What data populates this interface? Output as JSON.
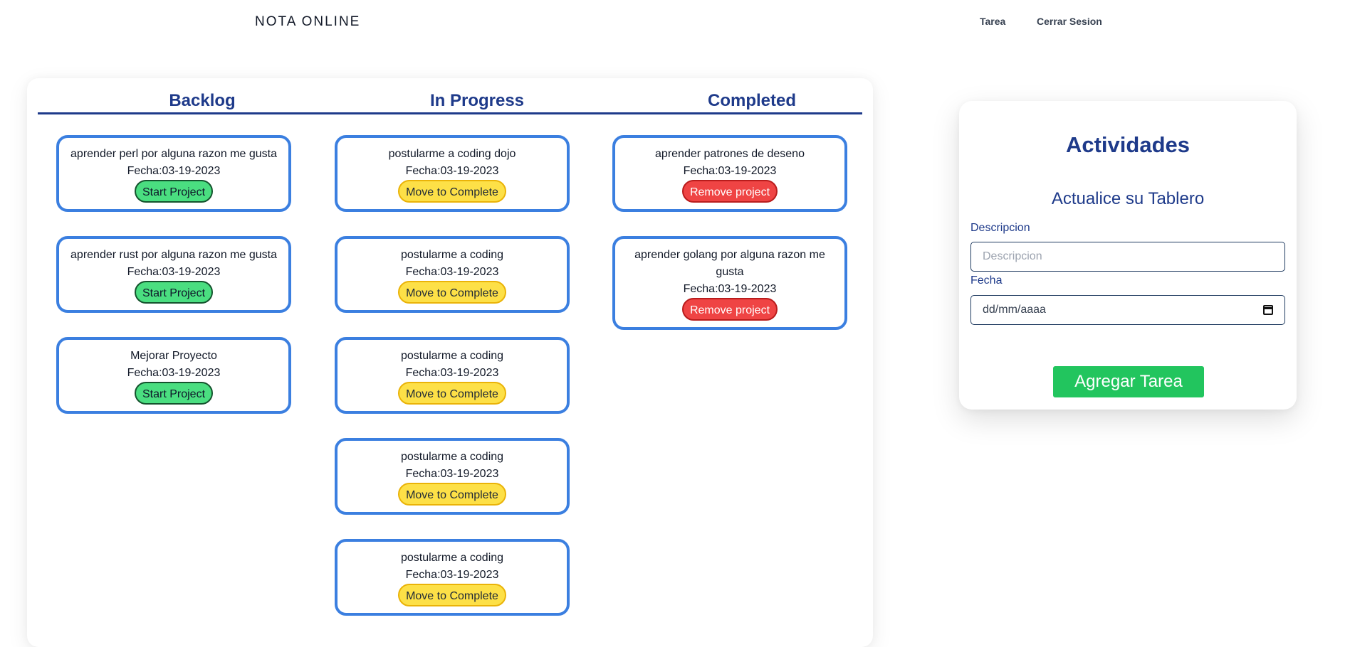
{
  "nav": {
    "brand": "NOTA ONLINE",
    "links": [
      "Tarea",
      "Cerrar Sesion"
    ]
  },
  "board": {
    "columns": [
      {
        "title": "Backlog",
        "cards": [
          {
            "text": "aprender perl por alguna razon me gusta",
            "fecha": "Fecha:03-19-2023",
            "action": "Start Project"
          },
          {
            "text": "aprender rust por alguna razon me gusta",
            "fecha": "Fecha:03-19-2023",
            "action": "Start Project"
          },
          {
            "text": "Mejorar Proyecto",
            "fecha": "Fecha:03-19-2023",
            "action": "Start Project"
          }
        ]
      },
      {
        "title": "In Progress",
        "cards": [
          {
            "text": "postularme a coding dojo",
            "fecha": "Fecha:03-19-2023",
            "action": "Move to Complete"
          },
          {
            "text": "postularme a coding",
            "fecha": "Fecha:03-19-2023",
            "action": "Move to Complete"
          },
          {
            "text": "postularme a coding",
            "fecha": "Fecha:03-19-2023",
            "action": "Move to Complete"
          },
          {
            "text": "postularme a coding",
            "fecha": "Fecha:03-19-2023",
            "action": "Move to Complete"
          },
          {
            "text": "postularme a coding",
            "fecha": "Fecha:03-19-2023",
            "action": "Move to Complete"
          }
        ]
      },
      {
        "title": "Completed",
        "cards": [
          {
            "text": "aprender patrones de deseno",
            "fecha": "Fecha:03-19-2023",
            "action": "Remove project"
          },
          {
            "text": "aprender golang por alguna razon me gusta",
            "fecha": "Fecha:03-19-2023",
            "action": "Remove project"
          }
        ]
      }
    ]
  },
  "form": {
    "title": "Actividades",
    "subtitle": "Actualice su Tablero",
    "descripcion_label": "Descripcion",
    "descripcion_placeholder": "Descripcion",
    "fecha_label": "Fecha",
    "fecha_placeholder": "dd/mm/aaaa",
    "submit_label": "Agregar Tarea"
  },
  "colors": {
    "accent": "#1e3a8a",
    "card_border": "#3b7fe0",
    "start": "#4ade80",
    "move": "#fde047",
    "remove": "#ef4444",
    "submit": "#22c55e"
  }
}
